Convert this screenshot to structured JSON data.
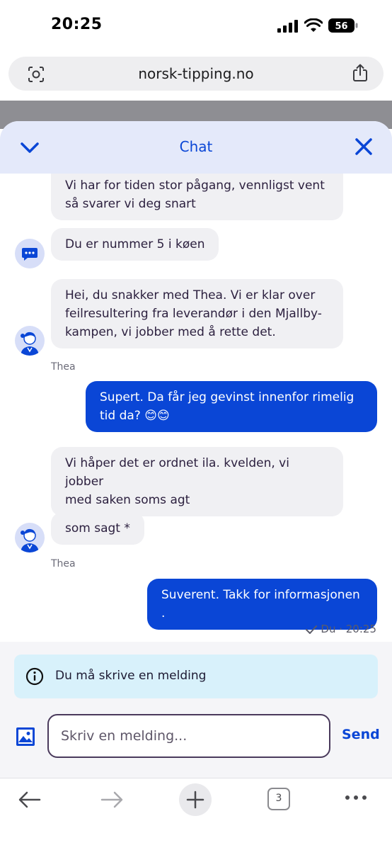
{
  "status_bar": {
    "time": "20:25",
    "battery": "56"
  },
  "browser": {
    "url": "norsk-tipping.no",
    "tab_count": "3"
  },
  "chat": {
    "title": "Chat",
    "messages": [
      {
        "from": "agent",
        "lines": [
          "Vi har for tiden stor pågang, vennligst vent",
          "så svarer vi deg snart"
        ]
      },
      {
        "from": "system",
        "lines": [
          "Du er nummer 5 i køen"
        ]
      },
      {
        "from": "agent",
        "lines": [
          "Hei, du snakker med Thea. Vi er klar over",
          "feilresultering fra leverandør i den Mjallby-",
          "kampen, vi jobber med å rette det."
        ],
        "sender": "Thea"
      },
      {
        "from": "user",
        "lines": [
          "Supert. Da får jeg gevinst innenfor rimelig",
          "tid da? 😊😊"
        ]
      },
      {
        "from": "agent",
        "lines": [
          "Vi håper det er ordnet ila. kvelden, vi jobber",
          "med saken soms agt"
        ]
      },
      {
        "from": "agent",
        "lines": [
          "som sagt *"
        ],
        "sender": "Thea"
      },
      {
        "from": "user",
        "lines": [
          "Suverent. Takk for informasjonen ."
        ],
        "meta": "Du · 20:25"
      }
    ]
  },
  "compose": {
    "notice": "Du må skrive en melding",
    "placeholder": "Skriv en melding...",
    "send_label": "Send"
  },
  "colors": {
    "brand_blue": "#0a46d6",
    "header_bg": "#e4e9fa",
    "notice_bg": "#d8f1fb"
  }
}
